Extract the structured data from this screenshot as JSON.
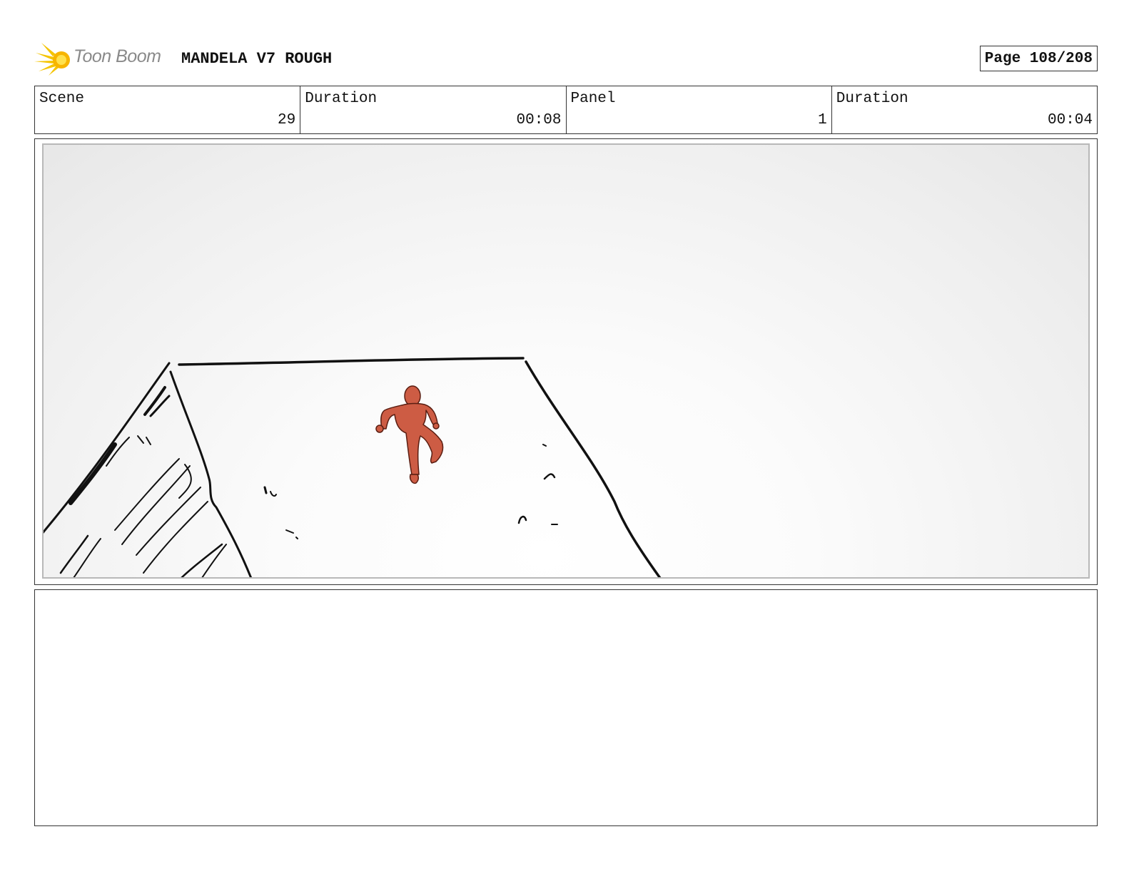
{
  "header": {
    "logo_text": "Toon Boom",
    "project_title": "MANDELA V7 ROUGH",
    "page_label": "Page 108/208"
  },
  "info": {
    "scene_label": "Scene",
    "scene_value": "29",
    "scene_duration_label": "Duration",
    "scene_duration_value": "00:08",
    "panel_label": "Panel",
    "panel_value": "1",
    "panel_duration_label": "Duration",
    "panel_duration_value": "00:04"
  },
  "notes": {
    "text": ""
  },
  "colors": {
    "character": "#cd5c44",
    "logo_yellow": "#f5c400",
    "logo_text": "#8a8a8a",
    "border": "#333333"
  },
  "icons": {
    "logo": "toon-boom-flare-icon"
  }
}
